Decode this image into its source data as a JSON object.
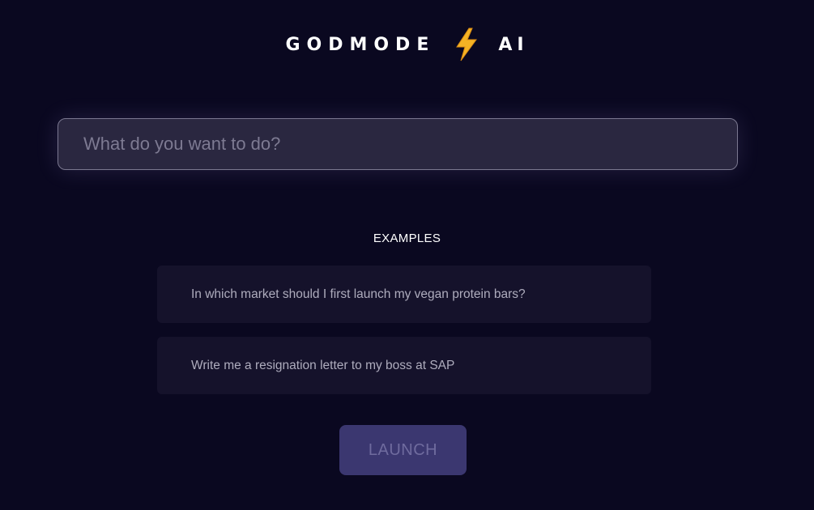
{
  "brand": {
    "word_left": "GODMODE",
    "icon": "lightning-bolt-icon",
    "word_right": "AI"
  },
  "search": {
    "placeholder": "What do you want to do?",
    "value": ""
  },
  "examples": {
    "title": "EXAMPLES",
    "items": [
      {
        "label": "In which market should I first launch my vegan protein bars?"
      },
      {
        "label": "Write me a resignation letter to my boss at SAP"
      }
    ]
  },
  "launch": {
    "label": "LAUNCH"
  },
  "colors": {
    "background": "#0a0820",
    "accent_button": "#3b3770",
    "card": "#15122b",
    "bolt": "#f5b324"
  }
}
